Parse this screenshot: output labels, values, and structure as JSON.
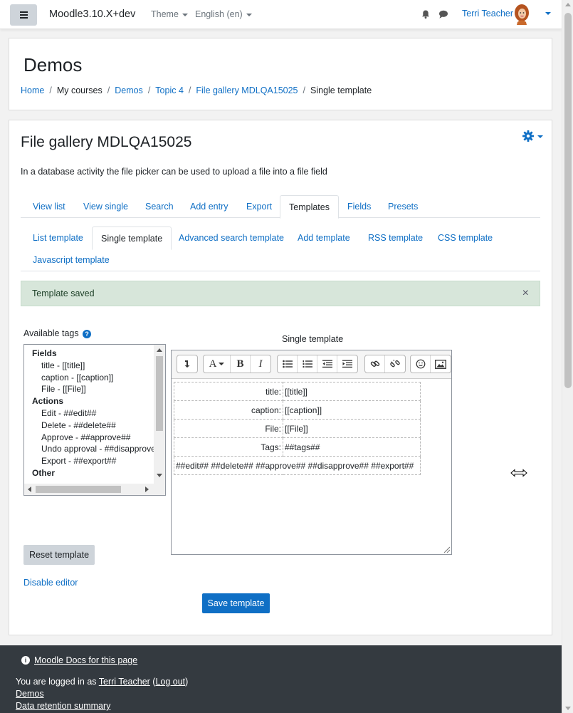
{
  "navbar": {
    "brand": "Moodle3.10.X+dev",
    "theme_label": "Theme",
    "language_label": "English (en)",
    "user_name": "Terri Teacher",
    "icons": [
      "hamburger-icon",
      "bell-icon",
      "chat-icon",
      "avatar",
      "caret-down-icon"
    ]
  },
  "header": {
    "title": "Demos",
    "breadcrumb": [
      "Home",
      "My courses",
      "Demos",
      "Topic 4",
      "File gallery MDLQA15025",
      "Single template"
    ]
  },
  "activity": {
    "title": "File gallery MDLQA15025",
    "intro": "In a database activity the file picker can be used to upload a file into a file field"
  },
  "tabs": [
    "View list",
    "View single",
    "Search",
    "Add entry",
    "Export",
    "Templates",
    "Fields",
    "Presets"
  ],
  "active_tab": "Templates",
  "subtabs": [
    "List template",
    "Single template",
    "Advanced search template",
    "Add template",
    "RSS template",
    "CSS template",
    "Javascript template"
  ],
  "active_subtab": "Single template",
  "alert": {
    "message": "Template saved",
    "close": "×"
  },
  "available_tags": {
    "label": "Available tags",
    "groups": [
      {
        "name": "Fields",
        "items": [
          "title - [[title]]",
          "caption - [[caption]]",
          "File - [[File]]"
        ]
      },
      {
        "name": "Actions",
        "items": [
          "Edit - ##edit##",
          "Delete - ##delete##",
          "Approve - ##approve##",
          "Undo approval - ##disapprove##",
          "Export - ##export##"
        ]
      },
      {
        "name": "Other",
        "items": []
      }
    ]
  },
  "editor": {
    "label": "Single template",
    "rows": [
      {
        "label": "title:",
        "value": "[[title]]"
      },
      {
        "label": "caption:",
        "value": "[[caption]]"
      },
      {
        "label": "File:",
        "value": "[[File]]"
      },
      {
        "label": "Tags:",
        "value": "##tags##"
      }
    ],
    "actions_row": "##edit## ##delete## ##approve## ##disapprove## ##export##"
  },
  "buttons": {
    "reset": "Reset template",
    "disable_editor": "Disable editor",
    "save": "Save template"
  },
  "footer": {
    "docs_link": "Moodle Docs for this page",
    "logged_prefix": "You are logged in as ",
    "logged_user": "Terri Teacher",
    "logout_open": " (",
    "logout": "Log out",
    "logout_close": ")",
    "course_link": "Demos",
    "retention_link": "Data retention summary"
  },
  "colors": {
    "accent": "#0f6fc5",
    "alert_bg": "#d7e6da",
    "footer_bg": "#343a40",
    "secondary_button": "#ced4da"
  }
}
